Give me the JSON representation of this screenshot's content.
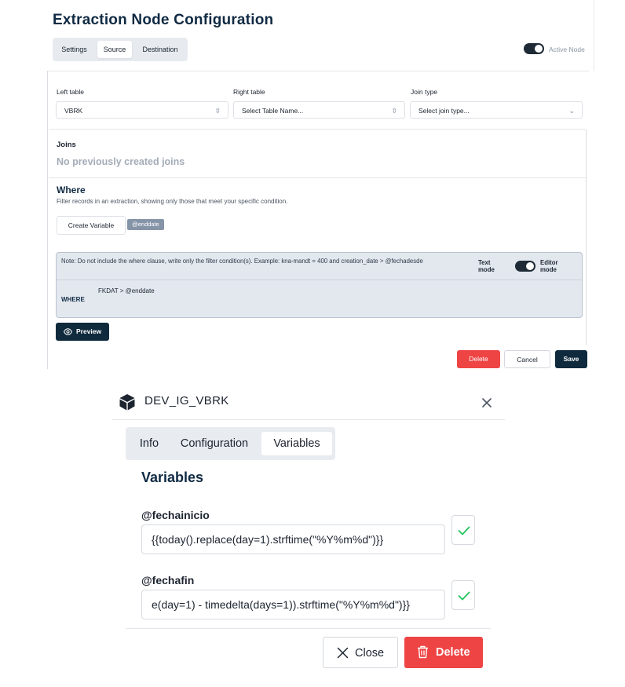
{
  "config": {
    "title": "Extraction Node Configuration",
    "tabs": [
      {
        "label": "Settings"
      },
      {
        "label": "Source"
      },
      {
        "label": "Destination"
      }
    ],
    "active_tab": "Source",
    "active_node_label": "Active Node",
    "left_table": {
      "label": "Left table",
      "value": "VBRK"
    },
    "right_table": {
      "label": "Right table",
      "placeholder": "Select Table Name..."
    },
    "join_type": {
      "label": "Join type",
      "placeholder": "Select join type..."
    },
    "joins": {
      "heading": "Joins",
      "empty": "No previously created joins"
    },
    "where": {
      "heading": "Where",
      "description": "Filter records in an extraction, showing only those that meet your specific condition.",
      "create_variable_label": "Create Variable",
      "variable_chip": "@enddate",
      "note": "Note: Do not include the where clause, write only the filter condition(s). Example: kna-mandt = 400 and creation_date > @fechadesde",
      "text_mode_label": [
        "Text",
        "mode"
      ],
      "editor_mode_label": [
        "Editor",
        "mode"
      ],
      "keyword": "WHERE",
      "condition": "FKDAT > @enddate"
    },
    "preview_label": "Preview",
    "delete_label": "Delete",
    "cancel_label": "Cancel",
    "save_label": "Save"
  },
  "modal": {
    "title": "DEV_IG_VBRK",
    "tabs": [
      {
        "label": "Info"
      },
      {
        "label": "Configuration"
      },
      {
        "label": "Variables"
      }
    ],
    "active_tab": "Variables",
    "heading": "Variables",
    "variables": [
      {
        "name": "@fechainicio",
        "value": "{{today().replace(day=1).strftime(\"%Y%m%d\")}}"
      },
      {
        "name": "@fechafin",
        "value": "e(day=1) - timedelta(days=1)).strftime(\"%Y%m%d\")}}"
      }
    ],
    "close_label": "Close",
    "delete_label": "Delete"
  },
  "colors": {
    "navy": "#0f2a3d",
    "danger": "#ef4444",
    "check": "#22c55e",
    "muted": "#a3acb7"
  }
}
